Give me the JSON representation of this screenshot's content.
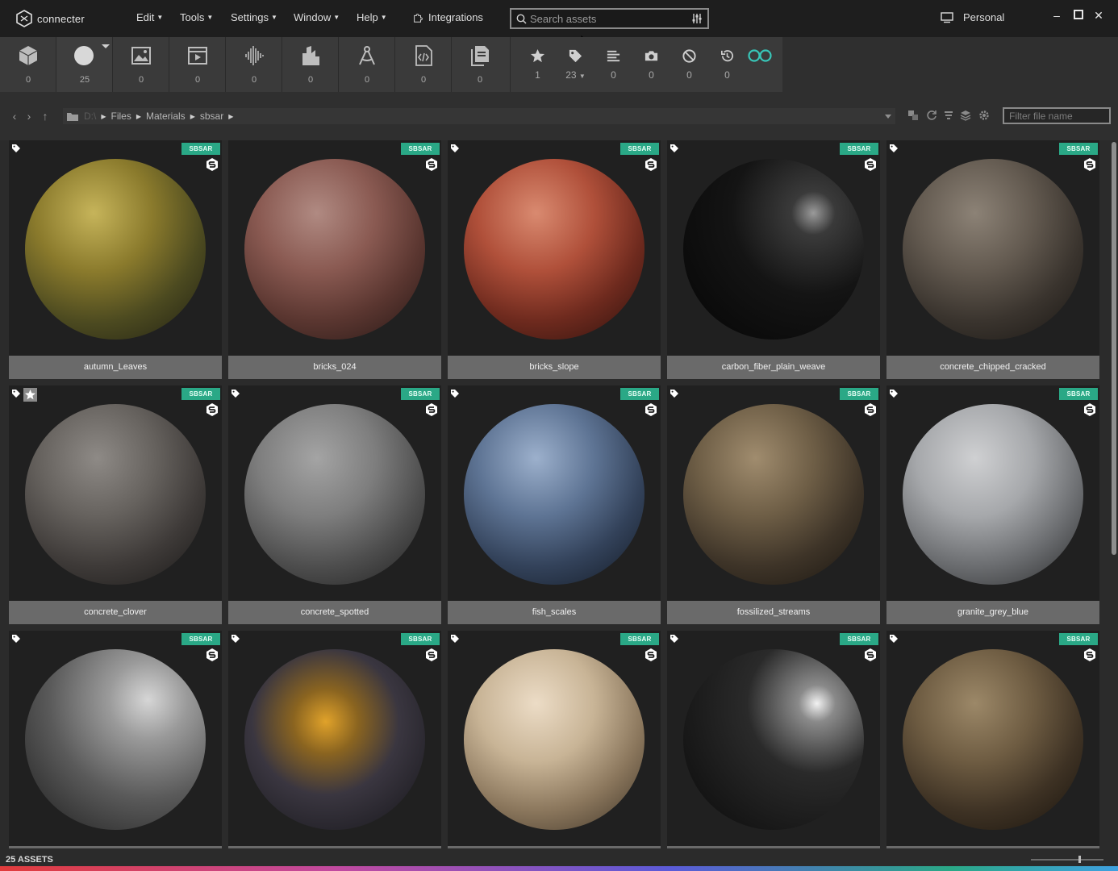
{
  "app": {
    "name": "connecter"
  },
  "menu": {
    "items": [
      "Edit",
      "Tools",
      "Settings",
      "Window",
      "Help"
    ],
    "integrations": "Integrations"
  },
  "search": {
    "placeholder": "Search assets"
  },
  "workspace": {
    "label": "Personal"
  },
  "type_toolbar": [
    {
      "icon": "cube-icon",
      "count": "0"
    },
    {
      "icon": "material-sphere-icon",
      "count": "25"
    },
    {
      "icon": "image-icon",
      "count": "0"
    },
    {
      "icon": "video-icon",
      "count": "0"
    },
    {
      "icon": "audio-icon",
      "count": "0"
    },
    {
      "icon": "building-icon",
      "count": "0"
    },
    {
      "icon": "compass-icon",
      "count": "0"
    },
    {
      "icon": "code-file-icon",
      "count": "0"
    },
    {
      "icon": "document-icon",
      "count": "0"
    }
  ],
  "filter_toolbar": [
    {
      "icon": "star-icon",
      "count": "1"
    },
    {
      "icon": "tag-icon",
      "count": "23"
    },
    {
      "icon": "list-icon",
      "count": "0"
    },
    {
      "icon": "camera-icon",
      "count": "0"
    },
    {
      "icon": "blocked-icon",
      "count": "0"
    },
    {
      "icon": "history-icon",
      "count": "0"
    },
    {
      "icon": "link-icon",
      "count": ""
    }
  ],
  "breadcrumb": {
    "drive": "D:\\",
    "parts": [
      "Files",
      "Materials",
      "sbsar"
    ]
  },
  "filter_name": {
    "placeholder": "Filter file name"
  },
  "badge_text": "SBSAR",
  "assets": [
    {
      "name": "autumn_Leaves",
      "starred": false
    },
    {
      "name": "bricks_024",
      "starred": false
    },
    {
      "name": "bricks_slope",
      "starred": false
    },
    {
      "name": "carbon_fiber_plain_weave",
      "starred": false
    },
    {
      "name": "concrete_chipped_cracked",
      "starred": false
    },
    {
      "name": "concrete_clover",
      "starred": true
    },
    {
      "name": "concrete_spotted",
      "starred": false
    },
    {
      "name": "fish_scales",
      "starred": false
    },
    {
      "name": "fossilized_streams",
      "starred": false
    },
    {
      "name": "granite_grey_blue",
      "starred": false
    },
    {
      "name": "",
      "starred": false
    },
    {
      "name": "",
      "starred": false
    },
    {
      "name": "",
      "starred": false
    },
    {
      "name": "",
      "starred": false
    },
    {
      "name": "",
      "starred": false
    }
  ],
  "status": {
    "asset_count": "25 ASSETS"
  },
  "colors": {
    "accent": "#2aa886",
    "link": "#38c6b8"
  }
}
